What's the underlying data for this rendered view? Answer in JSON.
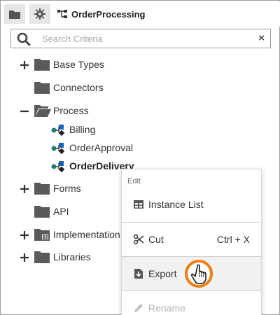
{
  "toolbar": {
    "files_icon": "folder-icon",
    "settings_icon": "gear-icon",
    "active_tab": {
      "icon": "process-flow-icon",
      "label": "OrderProcessing"
    }
  },
  "search": {
    "placeholder": "Search Criteria",
    "value": "",
    "clear_label": "×"
  },
  "tree": {
    "items": [
      {
        "label": "Base Types",
        "toggle": "+",
        "icon": "folder-icon"
      },
      {
        "label": "Connectors",
        "toggle": "",
        "icon": "folder-icon"
      },
      {
        "label": "Process",
        "toggle": "−",
        "icon": "folder-open-icon"
      },
      {
        "label": "Billing",
        "icon": "process-icon"
      },
      {
        "label": "OrderApproval",
        "icon": "process-icon"
      },
      {
        "label": "OrderDelivery",
        "icon": "process-icon",
        "selected": true
      },
      {
        "label": "Forms",
        "toggle": "+",
        "icon": "folder-icon"
      },
      {
        "label": "API",
        "toggle": "",
        "icon": "folder-icon"
      },
      {
        "label": "Implementation",
        "toggle": "+",
        "icon": "folder-grid-icon"
      },
      {
        "label": "Libraries",
        "toggle": "+",
        "icon": "folder-icon"
      }
    ]
  },
  "context_menu": {
    "header": "Edit",
    "items": [
      {
        "label": "Instance List",
        "icon": "table-icon",
        "shortcut": ""
      },
      {
        "label": "Cut",
        "icon": "scissors-icon",
        "shortcut": "Ctrl + X"
      },
      {
        "label": "Export",
        "icon": "export-icon",
        "shortcut": ""
      },
      {
        "label": "Rename",
        "icon": "pencil-icon",
        "shortcut": "",
        "disabled": true
      }
    ]
  },
  "colors": {
    "folder": "#5a5a5a",
    "accent_blue": "#1565c0",
    "cursor_ring": "#ef7d12",
    "menu_hover": "#f1f1f1"
  }
}
